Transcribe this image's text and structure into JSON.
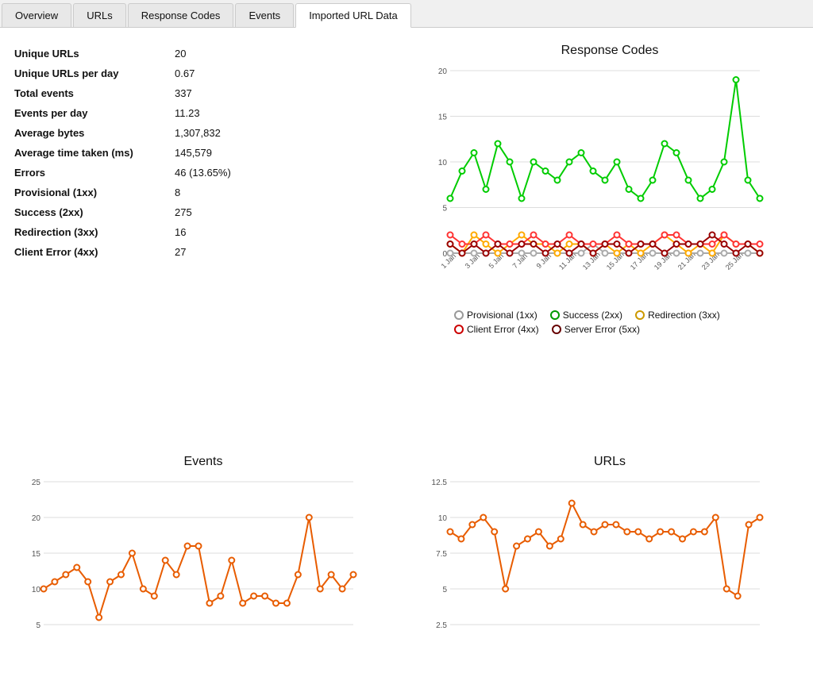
{
  "tabs": [
    {
      "label": "Overview",
      "active": false
    },
    {
      "label": "URLs",
      "active": false
    },
    {
      "label": "Response Codes",
      "active": false
    },
    {
      "label": "Events",
      "active": false
    },
    {
      "label": "Imported URL Data",
      "active": true
    }
  ],
  "stats": [
    {
      "label": "Unique URLs",
      "value": "20"
    },
    {
      "label": "Unique URLs per day",
      "value": "0.67"
    },
    {
      "label": "Total events",
      "value": "337"
    },
    {
      "label": "Events per day",
      "value": "11.23"
    },
    {
      "label": "Average bytes",
      "value": "1,307,832"
    },
    {
      "label": "Average time taken (ms)",
      "value": "145,579"
    },
    {
      "label": "Errors",
      "value": "46 (13.65%)"
    },
    {
      "label": "Provisional (1xx)",
      "value": "8"
    },
    {
      "label": "Success (2xx)",
      "value": "275"
    },
    {
      "label": "Redirection (3xx)",
      "value": "16"
    },
    {
      "label": "Client Error (4xx)",
      "value": "27"
    }
  ],
  "charts": {
    "response_codes": {
      "title": "Response Codes",
      "legend": [
        {
          "label": "Provisional (1xx)",
          "color": "#aaa",
          "borderColor": "#999"
        },
        {
          "label": "Success (2xx)",
          "color": "#00cc00",
          "borderColor": "#009900"
        },
        {
          "label": "Redirection (3xx)",
          "color": "#ffcc00",
          "borderColor": "#cc9900"
        },
        {
          "label": "Client Error (4xx)",
          "color": "#ff3333",
          "borderColor": "#cc0000"
        },
        {
          "label": "Server Error (5xx)",
          "color": "#990000",
          "borderColor": "#660000"
        }
      ]
    },
    "events": {
      "title": "Events"
    },
    "urls": {
      "title": "URLs"
    }
  }
}
